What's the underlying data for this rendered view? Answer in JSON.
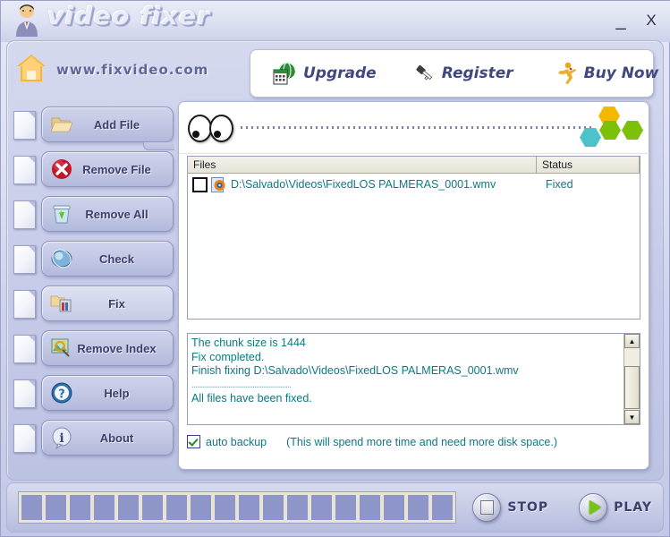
{
  "window": {
    "title": "video fixer",
    "minimize_label": "_",
    "close_label": "X"
  },
  "header": {
    "site_url": "www.fixvideo.com",
    "home_icon": "home-icon",
    "toolbar": [
      {
        "label": "Upgrade",
        "icon": "globe-calendar-icon"
      },
      {
        "label": "Register",
        "icon": "key-icon"
      },
      {
        "label": "Buy Now",
        "icon": "running-man-icon"
      }
    ]
  },
  "sidebar": {
    "items": [
      {
        "label": "Add File",
        "icon": "folder-open-icon",
        "active": false
      },
      {
        "label": "Remove File",
        "icon": "red-x-circle-icon",
        "active": false
      },
      {
        "label": "Remove All",
        "icon": "recycle-bin-icon",
        "active": false
      },
      {
        "label": "Check",
        "icon": "magnifier-disc-icon",
        "active": false
      },
      {
        "label": "Fix",
        "icon": "toolbox-icon",
        "active": true
      },
      {
        "label": "Remove Index",
        "icon": "image-index-icon",
        "active": false
      },
      {
        "label": "Help",
        "icon": "question-mark-icon",
        "active": false
      },
      {
        "label": "About",
        "icon": "info-icon",
        "active": false
      }
    ]
  },
  "main": {
    "status_strip": {
      "eyes_icon": "eyes-icon",
      "hex_colors": [
        "#f5b800",
        "#7cc00a",
        "#4bc3c8",
        "#7cc00a"
      ]
    },
    "filelist": {
      "columns": [
        "Files",
        "Status"
      ],
      "rows": [
        {
          "checked": false,
          "icon": "media-file-icon",
          "path": "D:\\Salvado\\Videos\\FixedLOS PALMERAS_0001.wmv",
          "status": "Fixed"
        }
      ]
    },
    "log": {
      "lines": [
        "The chunk size is 1444",
        "Fix completed.",
        "Finish fixing D:\\Salvado\\Videos\\FixedLOS PALMERAS_0001.wmv"
      ],
      "separator": "......................................................",
      "final_line": "All files have been fixed.",
      "scroll_up": "▲",
      "scroll_down": "▼"
    },
    "auto_backup": {
      "checked": true,
      "label": "auto backup",
      "note": "(This will spend more time and need more disk space.)"
    }
  },
  "bottom": {
    "progress_segments": 18,
    "stop_label": "STOP",
    "play_label": "PLAY"
  },
  "colors": {
    "accent_text": "#0b7a82",
    "button_text": "#3b3f6b",
    "toolbar_text": "#41477f",
    "site_text": "#5f6699",
    "progress_fill": "#8e95c8"
  }
}
